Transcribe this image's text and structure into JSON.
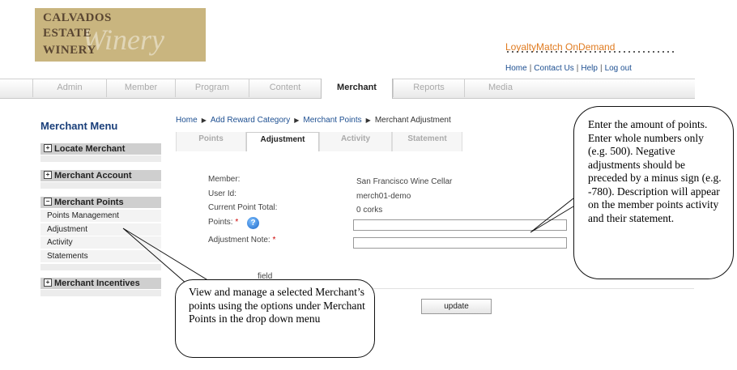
{
  "logo": {
    "line1": "CALVADOS",
    "line2": "ESTATE",
    "line3": "WINERY",
    "script": "Winery"
  },
  "brand": "LoyaltyMatch OnDemand",
  "toplinks": [
    "Home",
    "Contact Us",
    "Help",
    "Log out"
  ],
  "tabs": [
    "Admin",
    "Member",
    "Program",
    "Content",
    "Merchant",
    "Reports",
    "Media"
  ],
  "active_tab": "Merchant",
  "sidebar": {
    "title": "Merchant Menu",
    "sections": [
      "Locate Merchant",
      "Merchant Account",
      "Merchant Points",
      "Merchant Incentives"
    ],
    "points_items": [
      "Points Management",
      "Adjustment",
      "Activity",
      "Statements"
    ],
    "expand_symbol": "+",
    "collapse_symbol": "−"
  },
  "breadcrumb": [
    "Home",
    "Add Reward Category",
    "Merchant Points",
    "Merchant Adjustment"
  ],
  "subtabs": [
    "Points",
    "Adjustment",
    "Activity",
    "Statement"
  ],
  "form": {
    "member_label": "Member:",
    "member_value": "San Francisco Wine Cellar",
    "userid_label": "User Id:",
    "userid_value": "merch01-demo",
    "total_label": "Current Point Total:",
    "total_value": "0 corks",
    "points_label": "Points:",
    "note_label": "Adjustment Note:",
    "required_mark": "*",
    "required_hint": "field",
    "points_value": "",
    "note_value": "",
    "update_label": "update"
  },
  "callouts": {
    "right": "Enter the amount of points. Enter whole numbers only (e.g. 500). Negative adjustments should be preceded by a minus sign (e.g. -780). Description will appear on the member points activity and their statement.",
    "left": "View and manage a selected Merchant’s points using the options under Merchant Points in the drop down menu"
  },
  "colors": {
    "brand": "#e07b20",
    "link": "#1d4f91",
    "menu_title": "#1a3f7a",
    "logo_bg": "#c9b57f"
  }
}
